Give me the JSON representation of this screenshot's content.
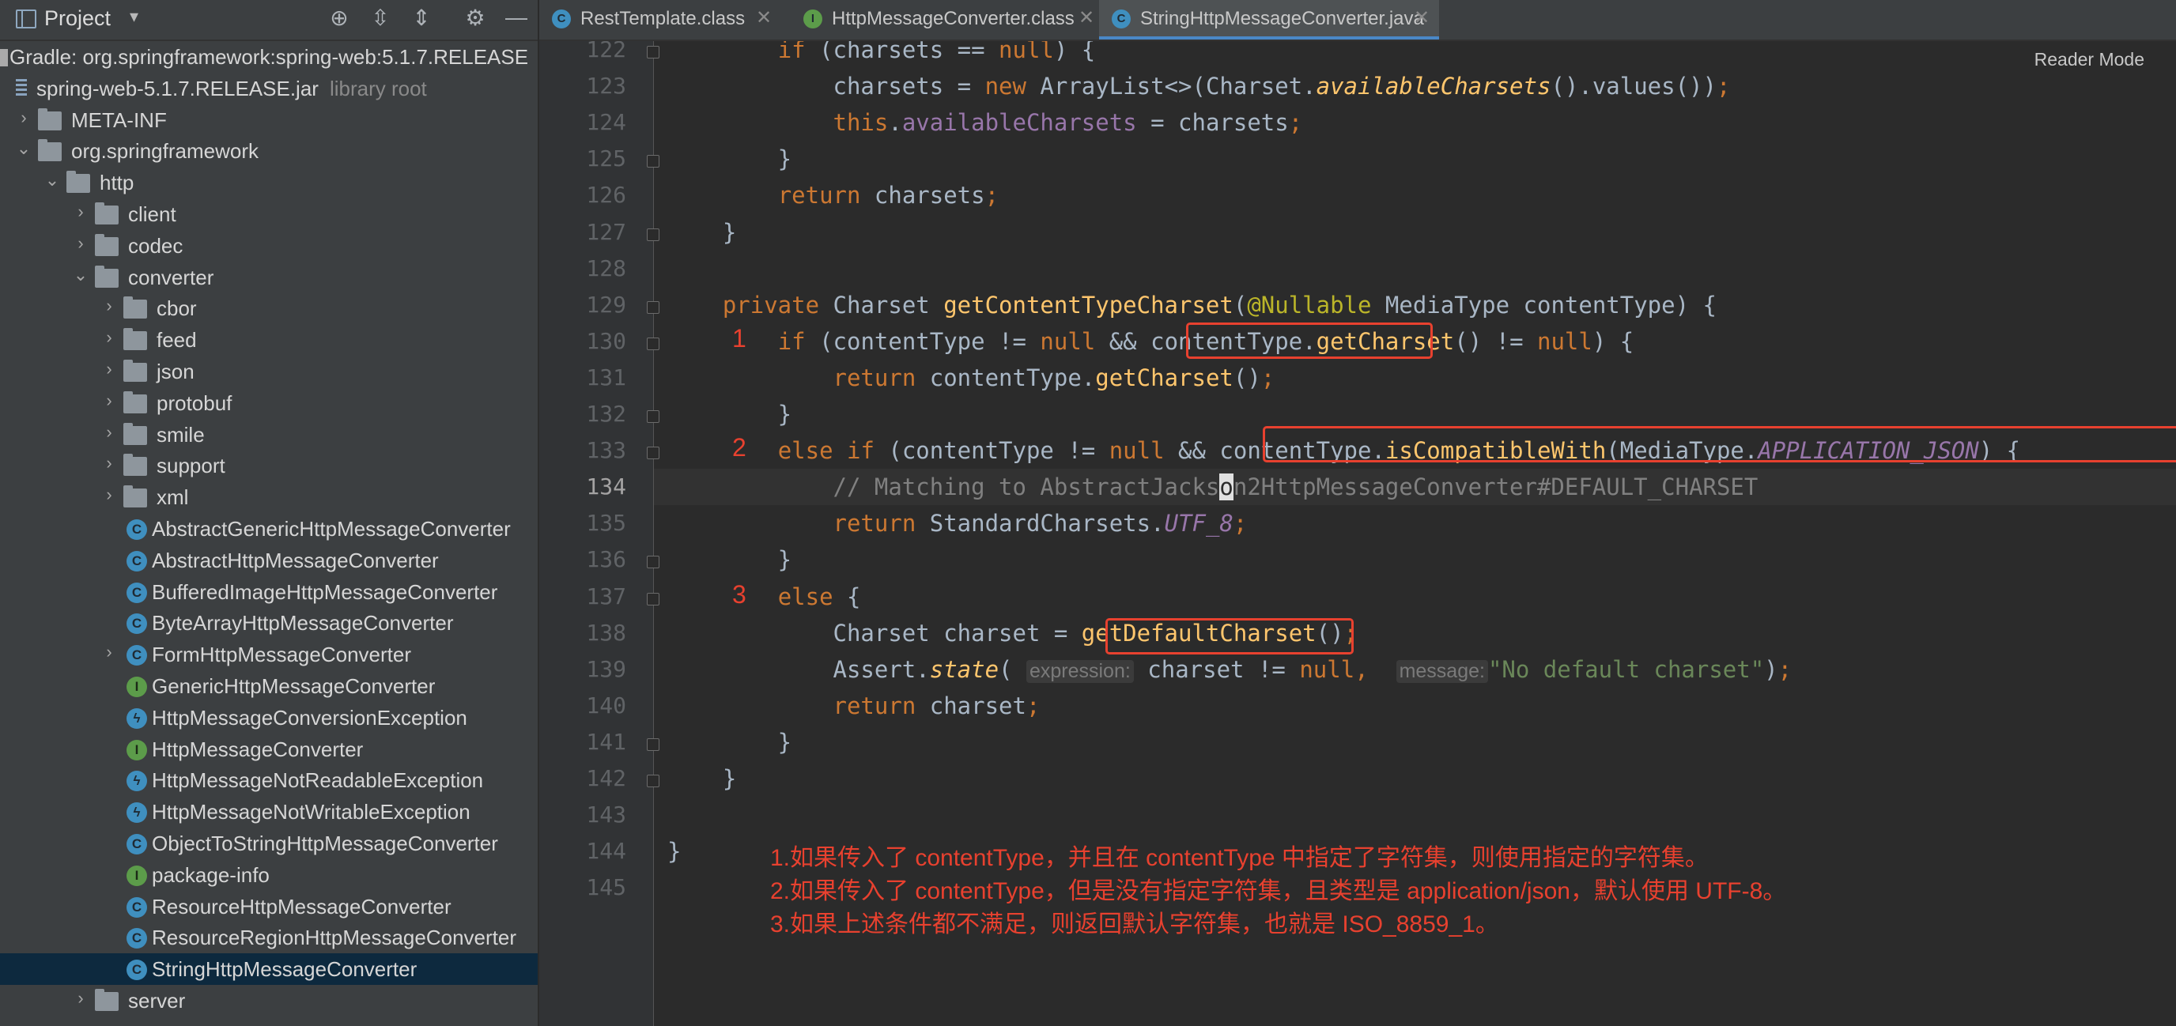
{
  "project_panel": {
    "title": "Project",
    "tree": [
      {
        "depth": 0,
        "kind": "gradle",
        "label": "Gradle: org.springframework:spring-web:5.1.7.RELEASE",
        "expanded": true
      },
      {
        "depth": 0,
        "kind": "jar",
        "label": "spring-web-5.1.7.RELEASE.jar",
        "hint": "library root"
      },
      {
        "depth": 0,
        "kind": "folder",
        "label": "META-INF",
        "arrow": "right"
      },
      {
        "depth": 0,
        "kind": "folder",
        "label": "org.springframework",
        "arrow": "down"
      },
      {
        "depth": 1,
        "kind": "folder",
        "label": "http",
        "arrow": "down"
      },
      {
        "depth": 2,
        "kind": "folder",
        "label": "client",
        "arrow": "right"
      },
      {
        "depth": 2,
        "kind": "folder",
        "label": "codec",
        "arrow": "right"
      },
      {
        "depth": 2,
        "kind": "folder",
        "label": "converter",
        "arrow": "down"
      },
      {
        "depth": 3,
        "kind": "folder",
        "label": "cbor",
        "arrow": "right"
      },
      {
        "depth": 3,
        "kind": "folder",
        "label": "feed",
        "arrow": "right"
      },
      {
        "depth": 3,
        "kind": "folder",
        "label": "json",
        "arrow": "right"
      },
      {
        "depth": 3,
        "kind": "folder",
        "label": "protobuf",
        "arrow": "right"
      },
      {
        "depth": 3,
        "kind": "folder",
        "label": "smile",
        "arrow": "right"
      },
      {
        "depth": 3,
        "kind": "folder",
        "label": "support",
        "arrow": "right"
      },
      {
        "depth": 3,
        "kind": "folder",
        "label": "xml",
        "arrow": "right"
      },
      {
        "depth": 3,
        "kind": "class-abstract",
        "label": "AbstractGenericHttpMessageConverter"
      },
      {
        "depth": 3,
        "kind": "class-abstract",
        "label": "AbstractHttpMessageConverter"
      },
      {
        "depth": 3,
        "kind": "class",
        "label": "BufferedImageHttpMessageConverter"
      },
      {
        "depth": 3,
        "kind": "class",
        "label": "ByteArrayHttpMessageConverter"
      },
      {
        "depth": 3,
        "kind": "class",
        "label": "FormHttpMessageConverter",
        "arrow": "right"
      },
      {
        "depth": 3,
        "kind": "interface",
        "label": "GenericHttpMessageConverter"
      },
      {
        "depth": 3,
        "kind": "exception",
        "label": "HttpMessageConversionException"
      },
      {
        "depth": 3,
        "kind": "interface",
        "label": "HttpMessageConverter"
      },
      {
        "depth": 3,
        "kind": "exception",
        "label": "HttpMessageNotReadableException"
      },
      {
        "depth": 3,
        "kind": "exception",
        "label": "HttpMessageNotWritableException"
      },
      {
        "depth": 3,
        "kind": "class",
        "label": "ObjectToStringHttpMessageConverter"
      },
      {
        "depth": 3,
        "kind": "interface",
        "label": "package-info"
      },
      {
        "depth": 3,
        "kind": "class",
        "label": "ResourceHttpMessageConverter"
      },
      {
        "depth": 3,
        "kind": "class",
        "label": "ResourceRegionHttpMessageConverter"
      },
      {
        "depth": 3,
        "kind": "class",
        "label": "StringHttpMessageConverter",
        "selected": true
      },
      {
        "depth": 2,
        "kind": "folder",
        "label": "server",
        "arrow": "right"
      }
    ]
  },
  "tabs": [
    {
      "label": "RestTemplate.class",
      "icon": "C"
    },
    {
      "label": "HttpMessageConverter.class",
      "icon": "I"
    },
    {
      "label": "StringHttpMessageConverter.java",
      "icon": "C",
      "active": true
    }
  ],
  "editor": {
    "reader_mode": "Reader Mode",
    "current_line": 134,
    "lines": [
      {
        "n": 122,
        "tokens": [
          [
            "",
            "        "
          ],
          [
            "kw",
            "if"
          ],
          [
            "",
            " (charsets == "
          ],
          [
            "kw",
            "null"
          ],
          [
            "",
            ") {"
          ]
        ]
      },
      {
        "n": 123,
        "tokens": [
          [
            "",
            "            charsets = "
          ],
          [
            "kw",
            "new"
          ],
          [
            "",
            " ArrayList<>(Charset."
          ],
          [
            "sfn",
            "availableCharsets"
          ],
          [
            "",
            "().values())"
          ],
          [
            "kw",
            ";"
          ]
        ]
      },
      {
        "n": 124,
        "tokens": [
          [
            "",
            "            "
          ],
          [
            "kw",
            "this"
          ],
          [
            "",
            "."
          ],
          [
            "fld",
            "availableCharsets"
          ],
          [
            "",
            " = charsets"
          ],
          [
            "kw",
            ";"
          ]
        ]
      },
      {
        "n": 125,
        "tokens": [
          [
            "",
            "        }"
          ]
        ]
      },
      {
        "n": 126,
        "tokens": [
          [
            "",
            "        "
          ],
          [
            "kw",
            "return"
          ],
          [
            "",
            " charsets"
          ],
          [
            "kw",
            ";"
          ]
        ]
      },
      {
        "n": 127,
        "tokens": [
          [
            "",
            "    }"
          ]
        ]
      },
      {
        "n": 128,
        "tokens": []
      },
      {
        "n": 129,
        "tokens": [
          [
            "",
            "    "
          ],
          [
            "kw",
            "private"
          ],
          [
            "",
            " Charset "
          ],
          [
            "fn",
            "getContentTypeCharset"
          ],
          [
            "",
            "("
          ],
          [
            "ann",
            "@Nullable"
          ],
          [
            "",
            " MediaType contentType) {"
          ]
        ]
      },
      {
        "n": 130,
        "tokens": [
          [
            "",
            "        "
          ],
          [
            "kw",
            "if"
          ],
          [
            "",
            " (contentType != "
          ],
          [
            "kw",
            "null"
          ],
          [
            "",
            " && contentType."
          ],
          [
            "fn",
            "getCharset"
          ],
          [
            "",
            "() != "
          ],
          [
            "kw",
            "null"
          ],
          [
            "",
            ") {"
          ]
        ]
      },
      {
        "n": 131,
        "tokens": [
          [
            "",
            "            "
          ],
          [
            "kw",
            "return"
          ],
          [
            "",
            " contentType."
          ],
          [
            "fn",
            "getCharset"
          ],
          [
            "",
            "()"
          ],
          [
            "kw",
            ";"
          ]
        ]
      },
      {
        "n": 132,
        "tokens": [
          [
            "",
            "        }"
          ]
        ]
      },
      {
        "n": 133,
        "tokens": [
          [
            "",
            "        "
          ],
          [
            "kw",
            "else if"
          ],
          [
            "",
            " (contentType != "
          ],
          [
            "kw",
            "null"
          ],
          [
            "",
            " && contentType."
          ],
          [
            "fn",
            "isCompatibleWith"
          ],
          [
            "",
            "(MediaType."
          ],
          [
            "cst",
            "APPLICATION_JSON"
          ],
          [
            "",
            ") {"
          ]
        ]
      },
      {
        "n": 134,
        "tokens": [
          [
            "cmt",
            "            // Matching to AbstractJacks"
          ],
          [
            "caret",
            "o"
          ],
          [
            "cmt",
            "n2HttpMessageConverter#DEFAULT_CHARSET"
          ]
        ]
      },
      {
        "n": 135,
        "tokens": [
          [
            "",
            "            "
          ],
          [
            "kw",
            "return"
          ],
          [
            "",
            " StandardCharsets."
          ],
          [
            "cst",
            "UTF_8"
          ],
          [
            "kw",
            ";"
          ]
        ]
      },
      {
        "n": 136,
        "tokens": [
          [
            "",
            "        }"
          ]
        ]
      },
      {
        "n": 137,
        "tokens": [
          [
            "",
            "        "
          ],
          [
            "kw",
            "else"
          ],
          [
            "",
            " {"
          ]
        ]
      },
      {
        "n": 138,
        "tokens": [
          [
            "",
            "            Charset charset = "
          ],
          [
            "fn",
            "getDefaultCharset"
          ],
          [
            "",
            "()"
          ],
          [
            "kw",
            ";"
          ]
        ]
      },
      {
        "n": 139,
        "tokens": [
          [
            "",
            "            Assert."
          ],
          [
            "sfn",
            "state"
          ],
          [
            "",
            "( "
          ],
          [
            "hint",
            "expression:"
          ],
          [
            "",
            " charset != "
          ],
          [
            "kw",
            "null"
          ],
          [
            "kw",
            ","
          ],
          [
            "",
            "  "
          ],
          [
            "hint",
            "message:"
          ],
          [
            "str",
            "\"No default charset\""
          ],
          [
            "",
            ")"
          ],
          [
            "kw",
            ";"
          ]
        ]
      },
      {
        "n": 140,
        "tokens": [
          [
            "",
            "            "
          ],
          [
            "kw",
            "return"
          ],
          [
            "",
            " charset"
          ],
          [
            "kw",
            ";"
          ]
        ]
      },
      {
        "n": 141,
        "tokens": [
          [
            "",
            "        }"
          ]
        ]
      },
      {
        "n": 142,
        "tokens": [
          [
            "",
            "    }"
          ]
        ]
      },
      {
        "n": 143,
        "tokens": []
      },
      {
        "n": 144,
        "tokens": [
          [
            "",
            "}"
          ]
        ]
      },
      {
        "n": 145,
        "tokens": []
      }
    ],
    "markers": [
      "1",
      "2",
      "3"
    ],
    "notes": [
      "1.如果传入了 contentType，并且在 contentType 中指定了字符集，则使用指定的字符集。",
      "2.如果传入了 contentType，但是没有指定字符集，且类型是 application/json，默认使用 UTF-8。",
      "3.如果上述条件都不满足，则返回默认字符集，也就是 ISO_8859_1。"
    ],
    "highlight_color": "#e8412f"
  }
}
